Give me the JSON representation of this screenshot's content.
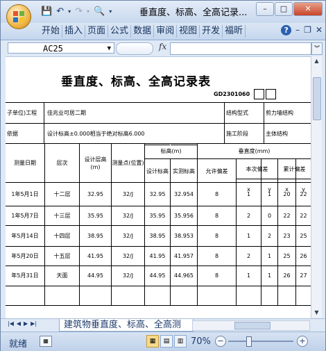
{
  "window": {
    "title": "垂直度、标高、全高记录..."
  },
  "qat": {
    "save_icon": "save-icon",
    "undo_icon": "undo-icon",
    "redo_icon": "redo-icon",
    "preview_icon": "print-preview-icon"
  },
  "ribbon": {
    "tabs": [
      "开始",
      "插入",
      "页面",
      "公式",
      "数据",
      "审阅",
      "视图",
      "开发",
      "福昕"
    ]
  },
  "formula_bar": {
    "name_box": "AC25",
    "fx": "fx",
    "content": ""
  },
  "doc": {
    "title": "垂直度、标高、全高记录表",
    "code": "GD2301060",
    "row1": {
      "label": "子单位)工程",
      "value": "佳兆业可居二期",
      "label2": "结构型式",
      "value2": "剪力墙结构"
    },
    "row2": {
      "label": "依据",
      "value": "设计标高±0.000相当于绝对标高6.000",
      "label2": "施工阶段",
      "value2": "主体结构"
    },
    "headers": {
      "date": "测量日期",
      "floor": "层次",
      "design_floor_h": "设计层高(m)",
      "point": "测量点(位置)",
      "elevation": "标高(m)",
      "design_el": "设计标高",
      "actual_el": "实测标高",
      "vertical": "垂直度(mm)",
      "allow": "允许偏差",
      "this_dev": "本次偏差",
      "cum_dev": "累计偏差",
      "x": "x",
      "y": "y"
    },
    "rows": [
      {
        "date": "1年5月1日",
        "floor": "十二层",
        "h": "32.95",
        "pt": "32/J",
        "de": "32.95",
        "ae": "32.954",
        "allow": "8",
        "x1": "1",
        "y1": "1",
        "x2": "20",
        "y2": "22"
      },
      {
        "date": "1年5月7日",
        "floor": "十三层",
        "h": "35.95",
        "pt": "32/J",
        "de": "35.95",
        "ae": "35.956",
        "allow": "8",
        "x1": "2",
        "y1": "0",
        "x2": "22",
        "y2": "22"
      },
      {
        "date": "年5月14日",
        "floor": "十四层",
        "h": "38.95",
        "pt": "32/J",
        "de": "38.95",
        "ae": "38.953",
        "allow": "8",
        "x1": "1",
        "y1": "2",
        "x2": "23",
        "y2": "25"
      },
      {
        "date": "年5月20日",
        "floor": "十五层",
        "h": "41.95",
        "pt": "32/J",
        "de": "41.95",
        "ae": "41.957",
        "allow": "8",
        "x1": "2",
        "y1": "1",
        "x2": "25",
        "y2": "26"
      },
      {
        "date": "年5月31日",
        "floor": "天面",
        "h": "44.95",
        "pt": "32/J",
        "de": "44.95",
        "ae": "44.965",
        "allow": "8",
        "x1": "1",
        "y1": "1",
        "x2": "26",
        "y2": "27"
      }
    ]
  },
  "sheet_tab": "建筑物垂直度、标高、全高测",
  "status": {
    "ready": "就绪",
    "zoom": "70%"
  }
}
